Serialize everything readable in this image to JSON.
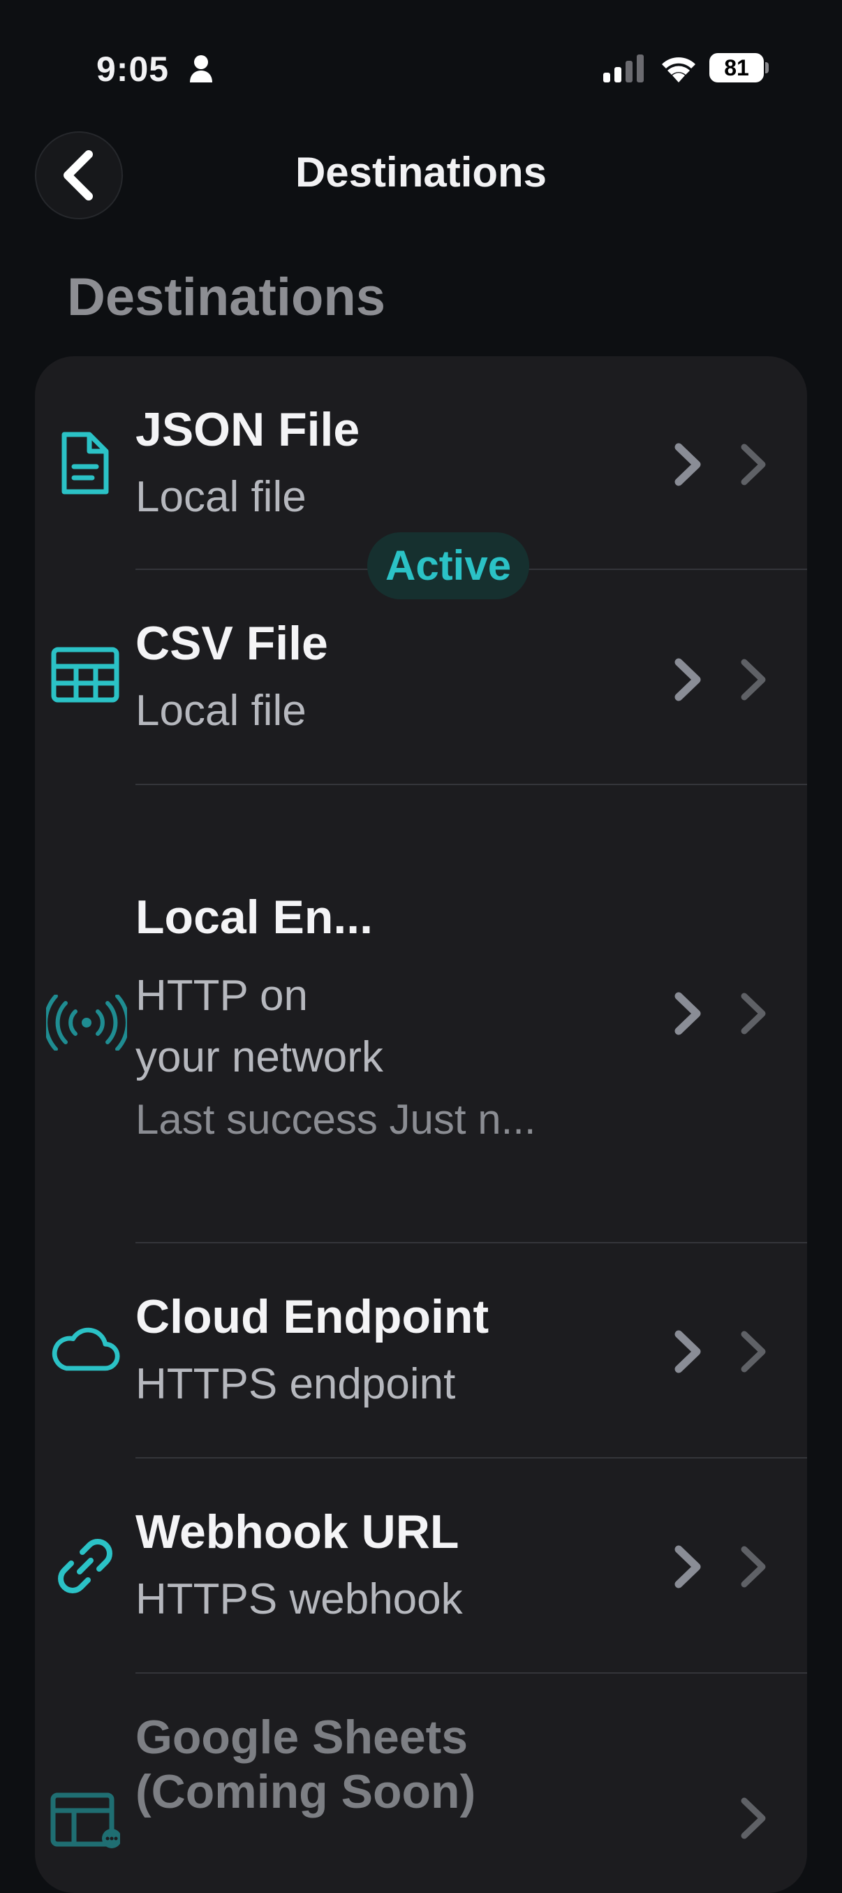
{
  "status": {
    "time": "9:05",
    "battery": "81"
  },
  "nav": {
    "title": "Destinations",
    "back_icon": "chevron-left-icon"
  },
  "section": {
    "title": "Destinations"
  },
  "destinations": [
    {
      "title": "JSON File",
      "subtitle": "Local file",
      "icon": "document-icon"
    },
    {
      "title": "CSV File",
      "subtitle": "Local file",
      "icon": "table-icon"
    },
    {
      "title": "Local En...",
      "badge": "Active",
      "subtitle_line1": "HTTP on",
      "subtitle_line2": "your network",
      "detail": "Last success Just n...",
      "icon": "broadcast-icon"
    },
    {
      "title": "Cloud Endpoint",
      "subtitle": "HTTPS endpoint",
      "icon": "cloud-icon"
    },
    {
      "title": "Webhook URL",
      "subtitle": "HTTPS webhook",
      "icon": "link-icon"
    },
    {
      "title_line1": "Google Sheets",
      "title_line2": "(Coming Soon)",
      "icon": "spreadsheet-icon"
    }
  ],
  "colors": {
    "accent": "#2bc2c6",
    "background": "#0d0f12",
    "card": "#1c1c1f",
    "chevron": "#8a8d96"
  }
}
